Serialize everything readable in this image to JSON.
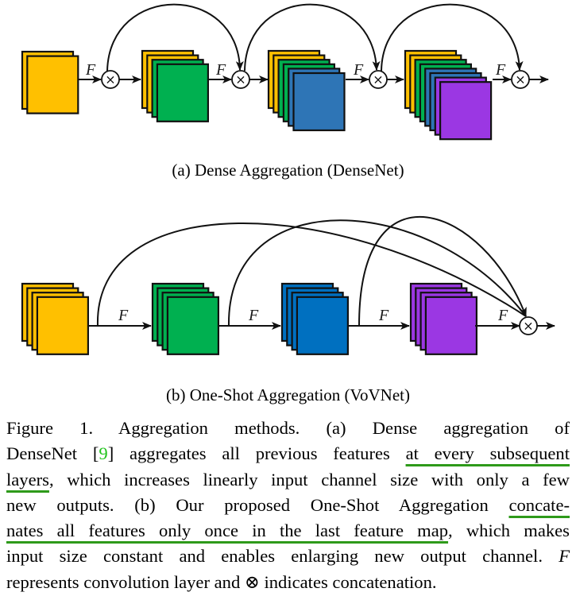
{
  "figure": {
    "colors": {
      "yellow": "#FFC000",
      "green": "#00B050",
      "blue_a": "#2E75B6",
      "blue_b": "#0070C0",
      "purple": "#9B37E3",
      "stroke": "#111111"
    },
    "operator_label": "F",
    "concat_symbol": "×",
    "panel_a": {
      "caption": "(a) Dense Aggregation (DenseNet)",
      "stages": [
        {
          "layers": [
            "yellow",
            "yellow"
          ]
        },
        {
          "layers": [
            "yellow",
            "yellow",
            "green",
            "green"
          ]
        },
        {
          "layers": [
            "yellow",
            "yellow",
            "green",
            "green",
            "blue_a",
            "blue_a"
          ]
        },
        {
          "layers": [
            "yellow",
            "yellow",
            "green",
            "green",
            "blue_a",
            "blue_a",
            "purple",
            "purple"
          ]
        }
      ]
    },
    "panel_b": {
      "caption": "(b) One-Shot Aggregation (VoVNet)",
      "stages": [
        {
          "layers": [
            "yellow",
            "yellow",
            "yellow",
            "yellow"
          ]
        },
        {
          "layers": [
            "green",
            "green",
            "green",
            "green"
          ]
        },
        {
          "layers": [
            "blue_b",
            "blue_b",
            "blue_b",
            "blue_b"
          ]
        },
        {
          "layers": [
            "purple",
            "purple",
            "purple",
            "purple"
          ]
        }
      ]
    }
  },
  "caption": {
    "lines": [
      [
        {
          "t": "Figure 1. Aggregation methods.   (a) Dense aggregation of"
        }
      ],
      [
        {
          "t": "DenseNet ["
        },
        {
          "t": "9",
          "ref": true
        },
        {
          "t": "] aggregates all previous features "
        },
        {
          "t": "at every subsequent",
          "ul": true
        }
      ],
      [
        {
          "t": "layers",
          "ul": true
        },
        {
          "t": ", which increases linearly input channel size with only a few"
        }
      ],
      [
        {
          "t": "new outputs.  (b) Our proposed One-Shot Aggregation "
        },
        {
          "t": "concate-",
          "ul": true
        }
      ],
      [
        {
          "t": "nates all features only once in the last feature map",
          "ul": true
        },
        {
          "t": ", which makes"
        }
      ],
      [
        {
          "t": "input size constant and enables enlarging new output channel.  "
        },
        {
          "t": "F",
          "it": true
        }
      ],
      [
        {
          "t": "represents convolution layer and ⊗ indicates concatenation."
        }
      ]
    ]
  }
}
